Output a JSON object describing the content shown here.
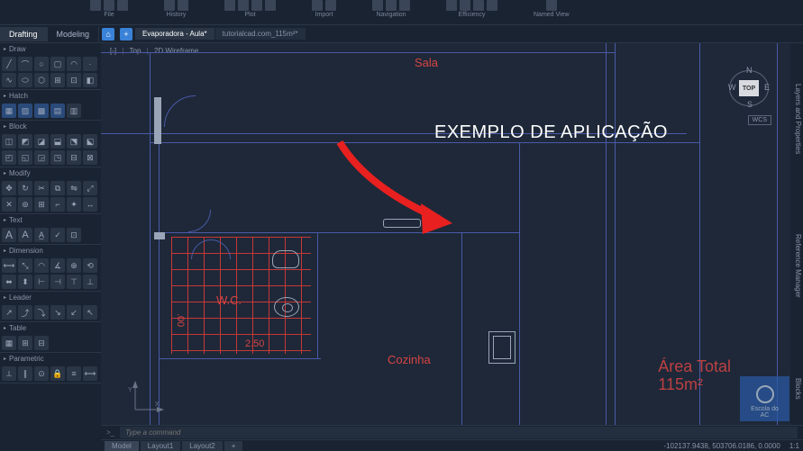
{
  "ribbon": {
    "groups": [
      {
        "name": "File",
        "label": "File"
      },
      {
        "name": "History",
        "label": "History"
      },
      {
        "name": "Plot",
        "label": "Plot"
      },
      {
        "name": "Import",
        "label": "Import"
      },
      {
        "name": "Navigation",
        "label": "Navigation"
      },
      {
        "name": "Efficiency",
        "label": "Efficiency"
      },
      {
        "name": "NamedView",
        "label": "Named View"
      }
    ]
  },
  "tabs": {
    "main": [
      {
        "label": "Drafting",
        "active": true
      },
      {
        "label": "Modeling",
        "active": false
      }
    ],
    "docs": [
      {
        "label": "Evaporadora - Aula*",
        "active": true
      },
      {
        "label": "tutorialcad.com_115m²*",
        "active": false
      }
    ]
  },
  "palette": {
    "sections": [
      {
        "title": "Draw"
      },
      {
        "title": "Hatch"
      },
      {
        "title": "Block"
      },
      {
        "title": "Modify"
      },
      {
        "title": "Text"
      },
      {
        "title": "Dimension"
      },
      {
        "title": "Leader"
      },
      {
        "title": "Table"
      },
      {
        "title": "Parametric"
      }
    ]
  },
  "viewport": {
    "orientation": "Top",
    "visual_style": "2D Wireframe",
    "nav_cube": {
      "face": "TOP",
      "n": "N",
      "s": "S",
      "e": "E",
      "w": "W"
    },
    "wcs_label": "WCS"
  },
  "drawing": {
    "rooms": {
      "sala": "Sala",
      "cozinha": "Cozinha",
      "wc": "W.C."
    },
    "dims": {
      "wc_width": "2.50",
      "wc_height": ".00"
    },
    "area_total_line1": "Área Total",
    "area_total_line2": "115m²",
    "overlay_title": "EXEMPLO DE APLICAÇÃO"
  },
  "right_tabs": [
    "Layers and Properties",
    "Reference Manager",
    "Blocks"
  ],
  "command_line": {
    "prompt_icon": ">_",
    "placeholder": "Type a command"
  },
  "status": {
    "model_tab": "Model",
    "layouts": [
      "Layout1",
      "Layout2",
      "+"
    ],
    "coords": "-102137.9438, 503706.0186, 0.0000",
    "scale": "1:1"
  },
  "logo": {
    "line1": "Escola do",
    "line2": "AC"
  }
}
